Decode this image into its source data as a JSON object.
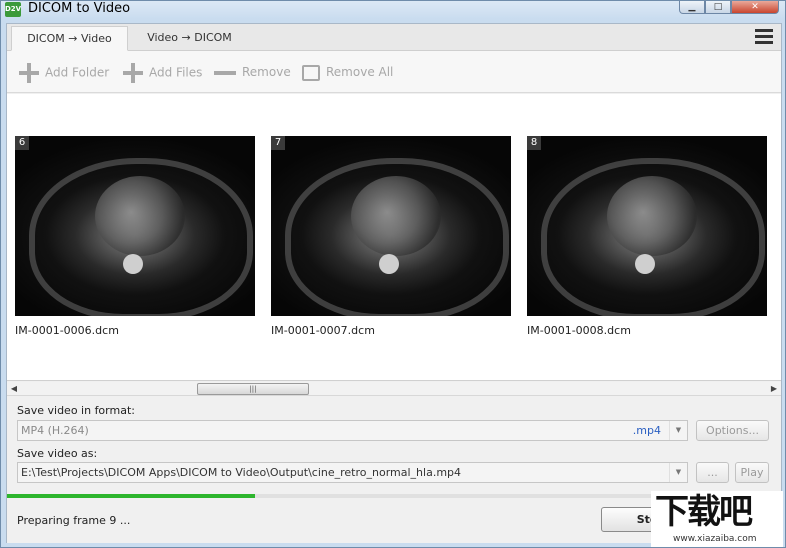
{
  "window": {
    "icon_text": "D2V",
    "title": "DICOM to Video",
    "min_glyph": "▁",
    "max_glyph": "□",
    "close_glyph": "✕"
  },
  "tabs": [
    {
      "label": "DICOM → Video",
      "active": true
    },
    {
      "label": "Video → DICOM",
      "active": false
    }
  ],
  "toolbar": {
    "add_folder": "Add Folder",
    "add_files": "Add Files",
    "remove": "Remove",
    "remove_all": "Remove All"
  },
  "thumbnails": [
    {
      "index": "6",
      "filename": "IM-0001-0006.dcm"
    },
    {
      "index": "7",
      "filename": "IM-0001-0007.dcm"
    },
    {
      "index": "8",
      "filename": "IM-0001-0008.dcm"
    }
  ],
  "scrollbar": {
    "left_arrow": "◀",
    "right_arrow": "▶",
    "grip": "|||"
  },
  "form": {
    "format_label": "Save video in format:",
    "format_value": "MP4 (H.264)",
    "format_ext": ".mp4",
    "dropdown_arrow": "▼",
    "options_button": "Options...",
    "save_as_label": "Save video as:",
    "save_as_value": "E:\\Test\\Projects\\DICOM Apps\\DICOM to Video\\Output\\cine_retro_normal_hla.mp4",
    "browse_button": "...",
    "play_button": "Play"
  },
  "progress": {
    "fraction": 0.32
  },
  "status": {
    "text": "Preparing frame 9 ...",
    "stop_button": "Stop"
  },
  "watermark": {
    "main": "下载吧",
    "url": "www.xiazaiba.com"
  },
  "colors": {
    "progress_fill": "#2db52d",
    "extension_text": "#2a5fc2"
  }
}
